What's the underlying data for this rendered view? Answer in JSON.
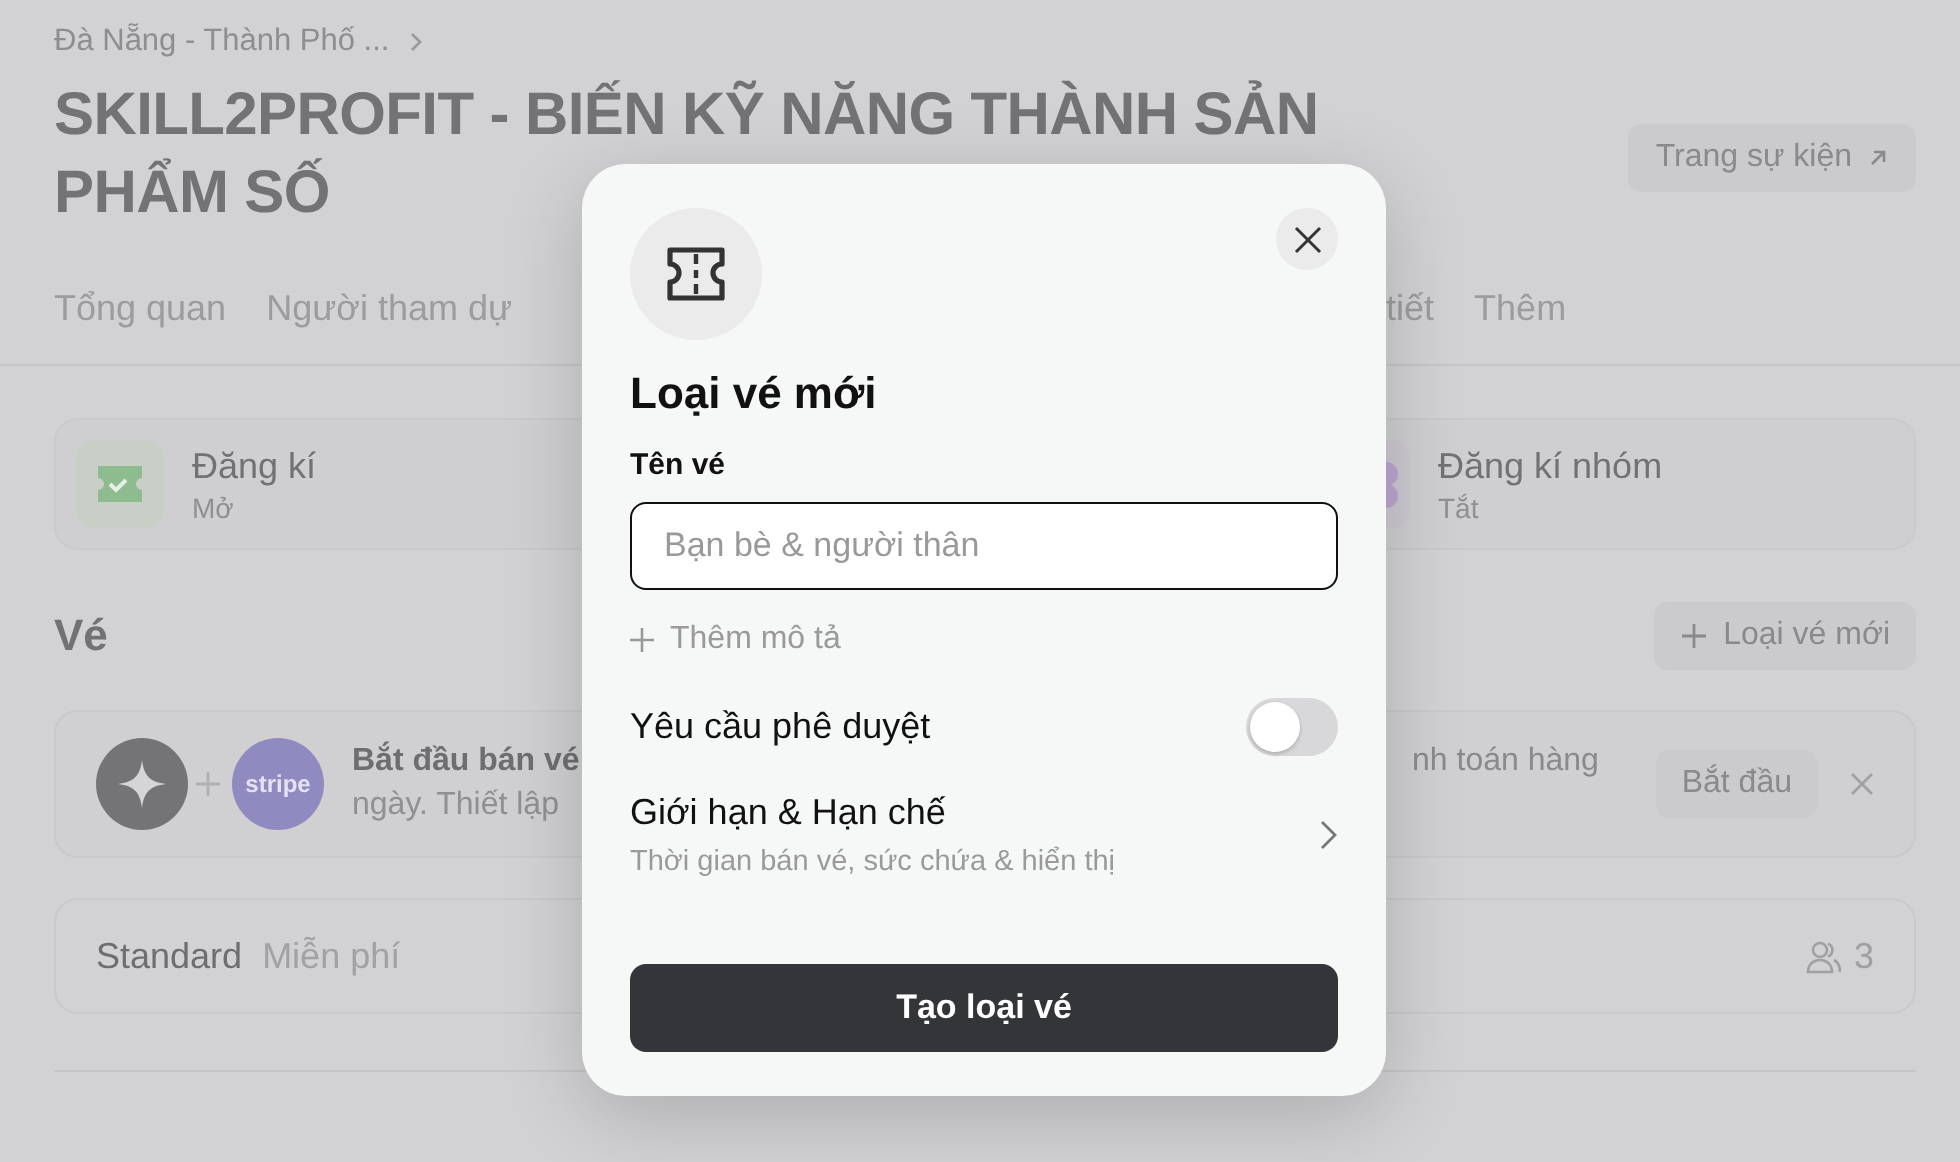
{
  "breadcrumb": "Đà Nẵng - Thành Phố ...",
  "title": "SKILL2PROFIT - BIẾN KỸ NĂNG THÀNH SẢN PHẨM SỐ",
  "event_page_button": "Trang sự kiện",
  "tabs": [
    {
      "label": "Tổng quan",
      "selected": false
    },
    {
      "label": "Người tham dự",
      "selected": false
    },
    {
      "label": "tiết",
      "selected": false
    },
    {
      "label": "Thêm",
      "selected": false
    }
  ],
  "registration_cards": [
    {
      "kind": "single",
      "title": "Đăng kí",
      "status": "Mở",
      "on": true
    },
    {
      "kind": "group",
      "title": "Đăng kí nhóm",
      "status": "Tắt",
      "on": false
    }
  ],
  "tickets_section": {
    "heading": "Vé",
    "new_button": "Loại vé mới"
  },
  "payment_banner": {
    "logo_text": "stripe",
    "title": "Bắt đầu bán vé",
    "title_right": "nh toán hàng",
    "subtitle": "ngày. Thiết lập",
    "start_button": "Bắt đầu"
  },
  "ticket_rows": [
    {
      "name": "Standard",
      "price": "Miễn phí",
      "count": "3"
    }
  ],
  "modal": {
    "title": "Loại vé mới",
    "name_label": "Tên vé",
    "name_placeholder": "Bạn bè & người thân",
    "add_description": "Thêm mô tả",
    "approval": {
      "label": "Yêu cầu phê duyệt",
      "on": false
    },
    "limits": {
      "title": "Giới hạn & Hạn chế",
      "subtitle": "Thời gian bán vé, sức chứa & hiển thị"
    },
    "submit": "Tạo loại vé"
  }
}
